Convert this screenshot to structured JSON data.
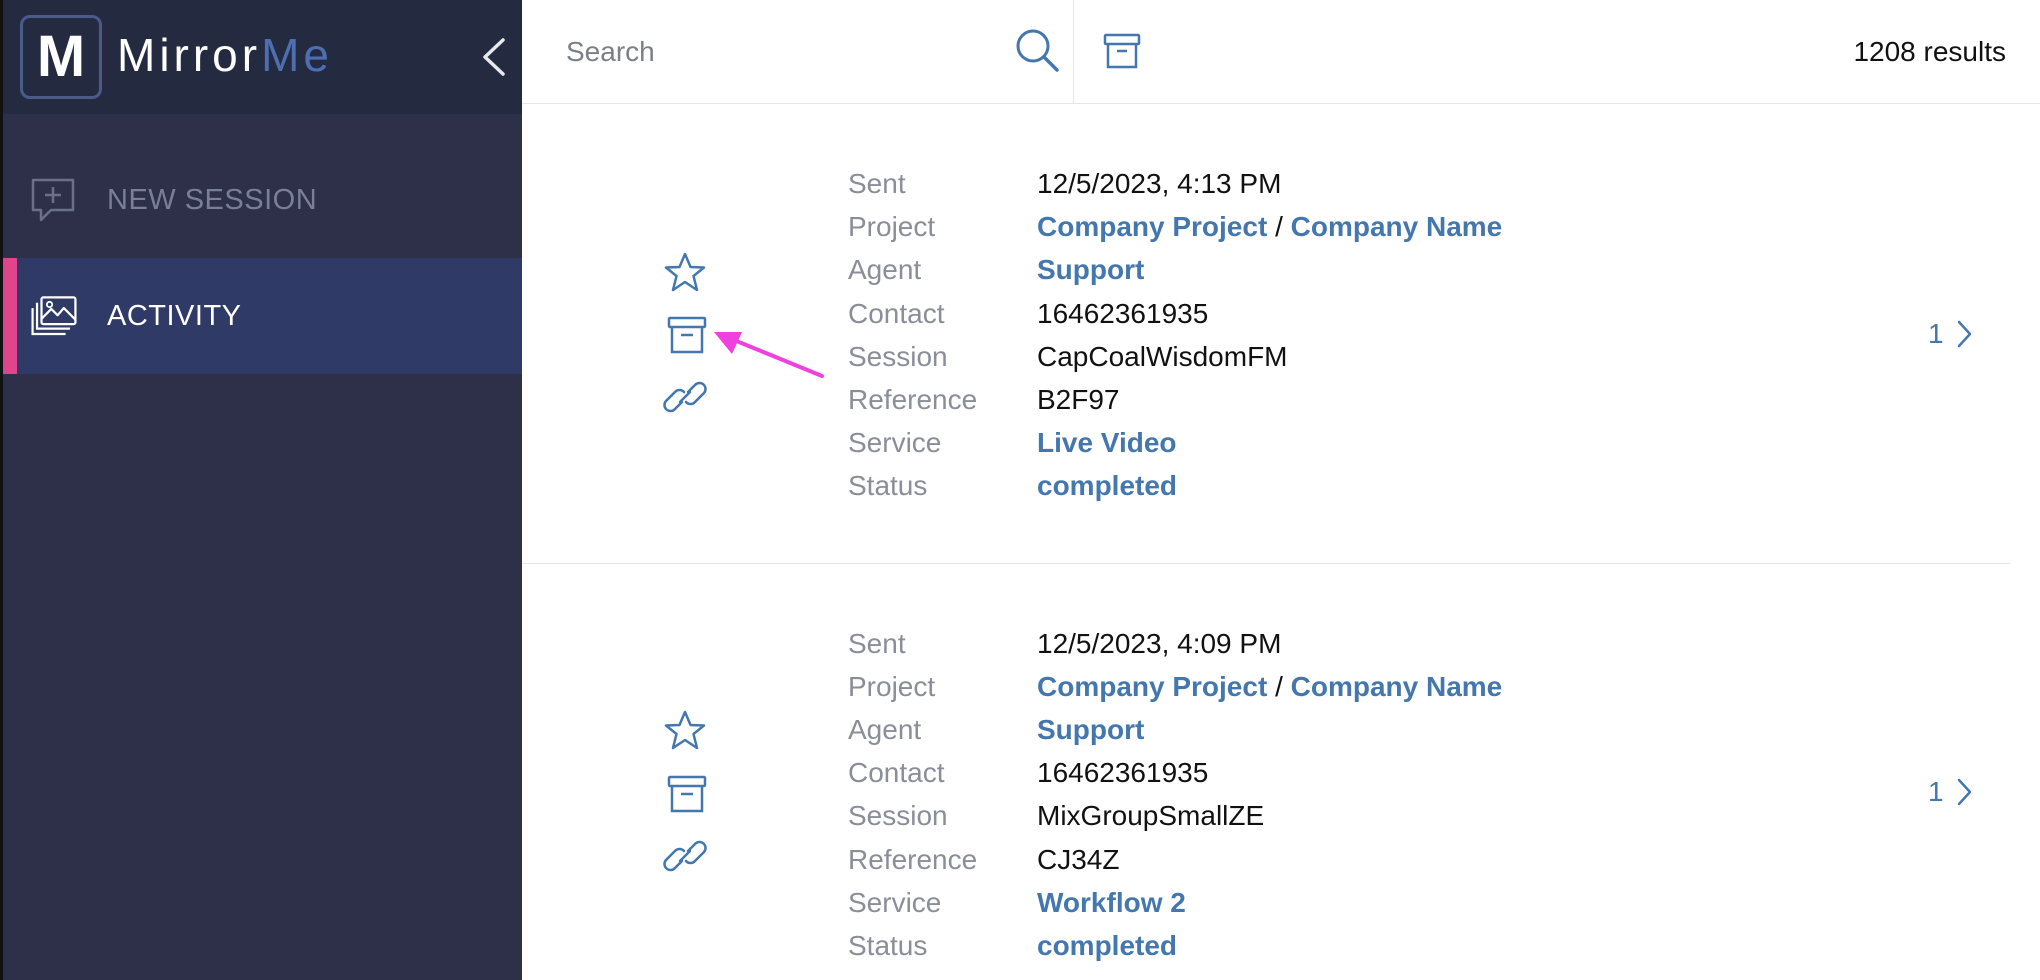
{
  "brand": {
    "letter": "M",
    "name_primary": "Mirror",
    "name_accent": "Me"
  },
  "colors": {
    "sidebar": "#2d3048",
    "brand_bar": "#242a40",
    "active_item": "#2f3a66",
    "active_marker": "#e0448a",
    "link": "#4377ad",
    "accent_brand": "#4d6fb1",
    "annotation": "#f040e0"
  },
  "sidebar": {
    "items": [
      {
        "label": "NEW SESSION",
        "icon": "chat-plus-icon",
        "active": false
      },
      {
        "label": "ACTIVITY",
        "icon": "images-icon",
        "active": true
      }
    ]
  },
  "toolbar": {
    "search_placeholder": "Search",
    "results": "1208 results"
  },
  "labels": {
    "sent": "Sent",
    "project": "Project",
    "agent": "Agent",
    "contact": "Contact",
    "session": "Session",
    "reference": "Reference",
    "service": "Service",
    "status": "Status"
  },
  "separator": "/",
  "sessions": [
    {
      "sent": "12/5/2023, 4:13 PM",
      "project": "Company Project",
      "company": "Company Name",
      "agent": "Support",
      "contact": "16462361935",
      "session": "CapCoalWisdomFM",
      "reference": "B2F97",
      "service": "Live Video",
      "status": "completed",
      "count": "1"
    },
    {
      "sent": "12/5/2023, 4:09 PM",
      "project": "Company Project",
      "company": "Company Name",
      "agent": "Support",
      "contact": "16462361935",
      "session": "MixGroupSmallZE",
      "reference": "CJ34Z",
      "service": "Workflow 2",
      "status": "completed",
      "count": "1"
    }
  ]
}
